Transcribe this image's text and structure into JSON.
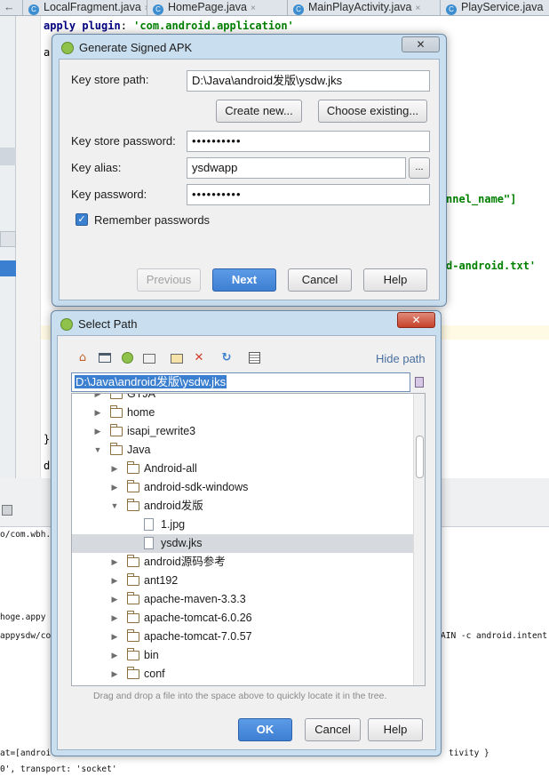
{
  "ide": {
    "tabs": [
      {
        "label": "LocalFragment.java"
      },
      {
        "label": "HomePage.java"
      },
      {
        "label": "MainPlayActivity.java"
      },
      {
        "label": "PlayService.java"
      }
    ],
    "code_line_1": "apply plugin: 'com.android.application'",
    "code_frag_a": "a",
    "code_channel": "nnel_name\"]",
    "code_proguard": "d-android.txt'",
    "code_brace": "}",
    "code_d": "d",
    "console_lines": [
      "o/com.wbh.",
      "hoge.appy",
      "appysdw/co",
      "AIN -c android.intent",
      "at=[androi",
      "tivity }",
      "0', transport: 'socket'"
    ]
  },
  "signed_apk": {
    "title": "Generate Signed APK",
    "close_label": "✕",
    "key_store_path_label": "Key store path:",
    "key_store_path_value": "D:\\Java\\android发版\\ysdw.jks",
    "create_new_label": "Create new...",
    "choose_existing_label": "Choose existing...",
    "key_store_password_label": "Key store password:",
    "key_store_password_value": "••••••••••",
    "key_alias_label": "Key alias:",
    "key_alias_value": "ysdwapp",
    "browse_label": "...",
    "key_password_label": "Key password:",
    "key_password_value": "••••••••••",
    "remember_label": "Remember passwords",
    "remember_checked": true,
    "previous_label": "Previous",
    "next_label": "Next",
    "cancel_label": "Cancel",
    "help_label": "Help"
  },
  "select_path": {
    "title": "Select Path",
    "close_label": "✕",
    "hide_path_label": "Hide path",
    "path_value": "D:\\Java\\android发版\\ysdw.jks",
    "toolbar_icons": [
      "home-icon",
      "desktop-icon",
      "android-icon",
      "project-icon",
      "new-folder-icon",
      "delete-icon",
      "refresh-icon",
      "show-hidden-icon"
    ],
    "tree": [
      {
        "name": "GTJA",
        "type": "folder",
        "level": 1,
        "state": "collapsed"
      },
      {
        "name": "home",
        "type": "folder",
        "level": 1,
        "state": "collapsed"
      },
      {
        "name": "isapi_rewrite3",
        "type": "folder",
        "level": 1,
        "state": "collapsed"
      },
      {
        "name": "Java",
        "type": "folder",
        "level": 1,
        "state": "expanded"
      },
      {
        "name": "Android-all",
        "type": "folder",
        "level": 2,
        "state": "collapsed"
      },
      {
        "name": "android-sdk-windows",
        "type": "folder",
        "level": 2,
        "state": "collapsed"
      },
      {
        "name": "android发版",
        "type": "folder",
        "level": 2,
        "state": "expanded"
      },
      {
        "name": "1.jpg",
        "type": "file",
        "level": 3,
        "state": "leaf"
      },
      {
        "name": "ysdw.jks",
        "type": "file",
        "level": 3,
        "state": "leaf",
        "selected": true
      },
      {
        "name": "android源码参考",
        "type": "folder",
        "level": 2,
        "state": "collapsed"
      },
      {
        "name": "ant192",
        "type": "folder",
        "level": 2,
        "state": "collapsed"
      },
      {
        "name": "apache-maven-3.3.3",
        "type": "folder",
        "level": 2,
        "state": "collapsed"
      },
      {
        "name": "apache-tomcat-6.0.26",
        "type": "folder",
        "level": 2,
        "state": "collapsed"
      },
      {
        "name": "apache-tomcat-7.0.57",
        "type": "folder",
        "level": 2,
        "state": "collapsed"
      },
      {
        "name": "bin",
        "type": "folder",
        "level": 2,
        "state": "collapsed"
      },
      {
        "name": "conf",
        "type": "folder",
        "level": 2,
        "state": "collapsed"
      }
    ],
    "drag_hint": "Drag and drop a file into the space above to quickly locate it in the tree.",
    "ok_label": "OK",
    "cancel_label": "Cancel",
    "help_label": "Help"
  }
}
